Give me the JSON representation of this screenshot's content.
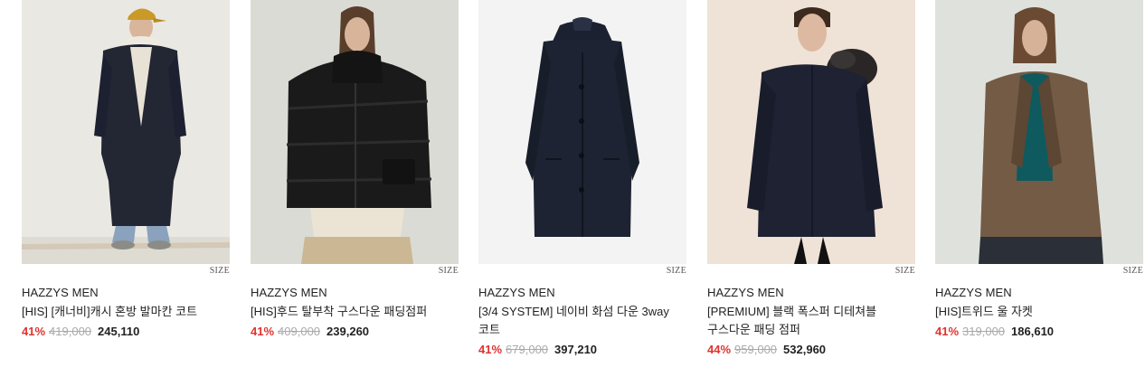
{
  "size_label": "SIZE",
  "colors": {
    "discount": "#e0322e",
    "original_price": "#aaaaaa",
    "text": "#222222"
  },
  "products": [
    {
      "brand": "HAZZYS MEN",
      "name": "[HIS] [캐너비]캐시 혼방 발마칸 코트",
      "discount": "41%",
      "original_price": "419,000",
      "sale_price": "245,110",
      "image": "model in long navy balmacaan coat with yellow cap"
    },
    {
      "brand": "HAZZYS MEN",
      "name": "[HIS]후드 탈부착 구스다운 패딩점퍼",
      "discount": "41%",
      "original_price": "409,000",
      "sale_price": "239,260",
      "image": "model in black hooded goose down padded jumper"
    },
    {
      "brand": "HAZZYS MEN",
      "name": "[3/4 SYSTEM] 네이비 화섬 다운 3way 코트",
      "discount": "41%",
      "original_price": "679,000",
      "sale_price": "397,210",
      "image": "navy down 3way coat product shot"
    },
    {
      "brand": "HAZZYS MEN",
      "name": "[PREMIUM] 블랙 폭스퍼 디테쳐블 구스다운 패딩 점퍼",
      "discount": "44%",
      "original_price": "959,000",
      "sale_price": "532,960",
      "image": "smiling model in black fox fur hooded padded jumper"
    },
    {
      "brand": "HAZZYS MEN",
      "name": "[HIS]트위드 울 자켓",
      "discount": "41%",
      "original_price": "319,000",
      "sale_price": "186,610",
      "image": "model in brown tweed wool jacket with green sweater"
    }
  ]
}
